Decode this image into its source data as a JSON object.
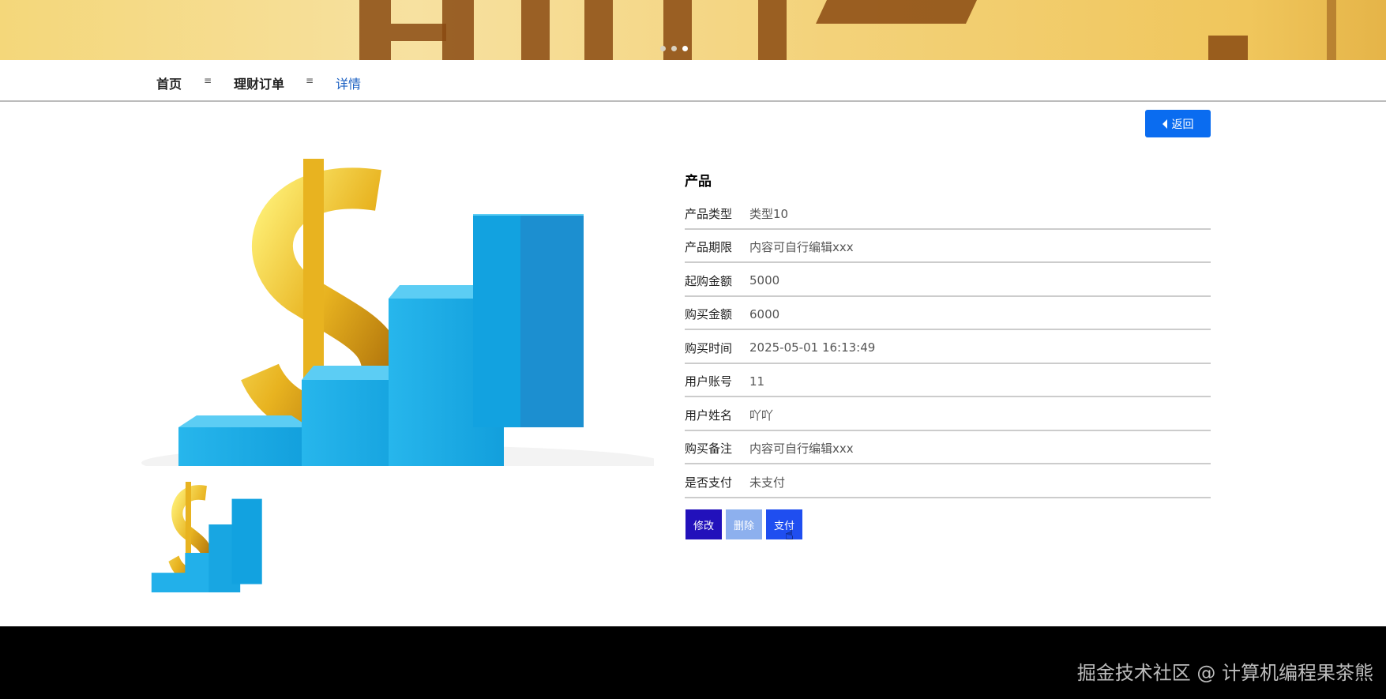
{
  "banner": {
    "slide_count": 3,
    "active_slide": 3
  },
  "breadcrumb": {
    "items": [
      "首页",
      "理财订单",
      "详情"
    ],
    "separator": "≡"
  },
  "back_button": {
    "label": "返回"
  },
  "detail": {
    "title": "产品",
    "fields": [
      {
        "label": "产品类型",
        "value": "类型10"
      },
      {
        "label": "产品期限",
        "value": "内容可自行编辑xxx"
      },
      {
        "label": "起购金额",
        "value": "5000"
      },
      {
        "label": "购买金额",
        "value": "6000"
      },
      {
        "label": "购买时间",
        "value": "2025-05-01 16:13:49"
      },
      {
        "label": "用户账号",
        "value": "11"
      },
      {
        "label": "用户姓名",
        "value": "吖吖"
      },
      {
        "label": "购买备注",
        "value": "内容可自行编辑xxx"
      },
      {
        "label": "是否支付",
        "value": "未支付"
      }
    ]
  },
  "actions": {
    "edit": "修改",
    "delete": "删除",
    "pay": "支付"
  },
  "colors": {
    "edit": "#2211bb",
    "delete": "#8db0ee",
    "pay": "#1f4ef0",
    "back": "#0a6cf0",
    "crumb_active": "#1a5fc2"
  },
  "footer": {
    "watermark": "掘金技术社区 @ 计算机编程果茶熊"
  }
}
